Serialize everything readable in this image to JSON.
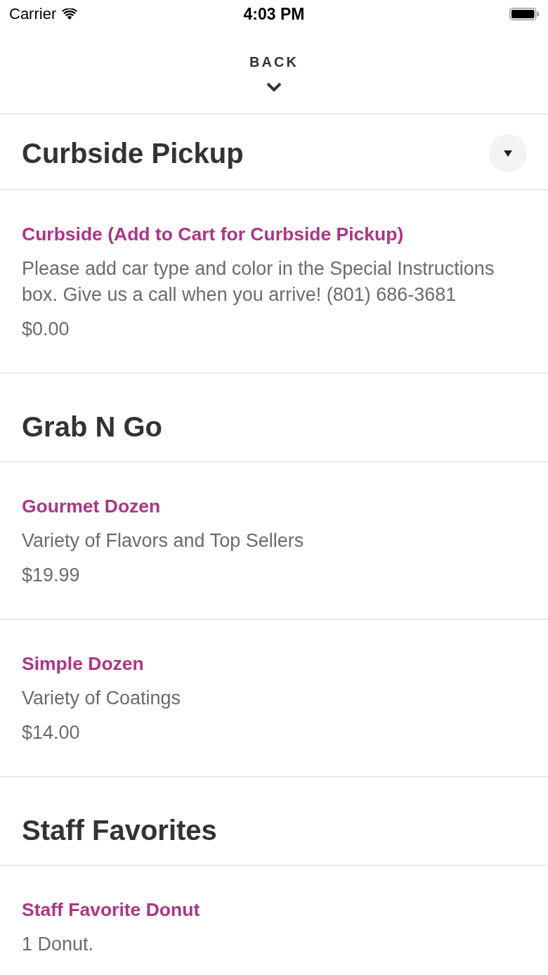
{
  "status_bar": {
    "carrier": "Carrier",
    "time": "4:03 PM"
  },
  "header": {
    "back_label": "BACK"
  },
  "sections": [
    {
      "title": "Curbside Pickup",
      "menu_button": true,
      "items": [
        {
          "name": "Curbside (Add to Cart for Curbside Pickup)",
          "description": "Please add car type and color in the Special Instructions box. Give us a call when you arrive! (801) 686-3681",
          "price": "$0.00"
        }
      ]
    },
    {
      "title": "Grab N Go",
      "menu_button": false,
      "items": [
        {
          "name": "Gourmet Dozen",
          "description": "Variety of Flavors and Top Sellers",
          "price": "$19.99"
        },
        {
          "name": "Simple Dozen",
          "description": "Variety of Coatings",
          "price": "$14.00"
        }
      ]
    },
    {
      "title": "Staff Favorites",
      "menu_button": false,
      "items": [
        {
          "name": "Staff Favorite Donut",
          "description": "1 Donut."
        }
      ]
    }
  ]
}
